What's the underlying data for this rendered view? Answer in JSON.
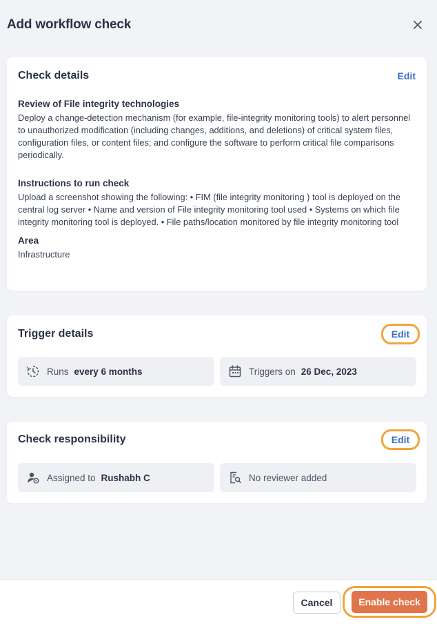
{
  "dialog": {
    "title": "Add workflow check",
    "close_icon": "close-icon"
  },
  "check_details": {
    "title": "Check details",
    "edit_label": "Edit",
    "review_label": "Review of File integrity technologies",
    "review_text": "Deploy a change-detection mechanism (for example, file-integrity monitoring tools) to alert personnel to unauthorized modification (including changes, additions, and deletions) of critical system files, configuration files, or content files; and configure the software to perform critical file comparisons periodically.",
    "instructions_label": "Instructions to run check",
    "instructions_text": "Upload a screenshot showing the following: • FIM (file integrity monitoring ) tool is deployed on the central log server • Name and version of File integrity monitoring tool used • Systems on which file integrity monitoring tool is deployed. • File paths/location monitored by file integrity monitoring tool",
    "area_label": "Area",
    "area_value": "Infrastructure"
  },
  "trigger_details": {
    "title": "Trigger details",
    "edit_label": "Edit",
    "runs_label": "Runs",
    "runs_value": "every 6 months",
    "runs_icon": "recurring-clock-icon",
    "triggers_label": "Triggers on",
    "triggers_value": "26 Dec, 2023",
    "triggers_icon": "calendar-icon"
  },
  "check_responsibility": {
    "title": "Check responsibility",
    "edit_label": "Edit",
    "assigned_label": "Assigned to",
    "assigned_value": "Rushabh C",
    "assigned_icon": "user-assign-icon",
    "reviewer_text": "No reviewer added",
    "reviewer_icon": "reviewer-search-icon"
  },
  "footer": {
    "cancel_label": "Cancel",
    "enable_label": "Enable check"
  },
  "colors": {
    "accent_link": "#3b6cc4",
    "primary_button": "#e0744a",
    "highlight_ring": "#f0a43c",
    "background": "#f1f3f7"
  }
}
